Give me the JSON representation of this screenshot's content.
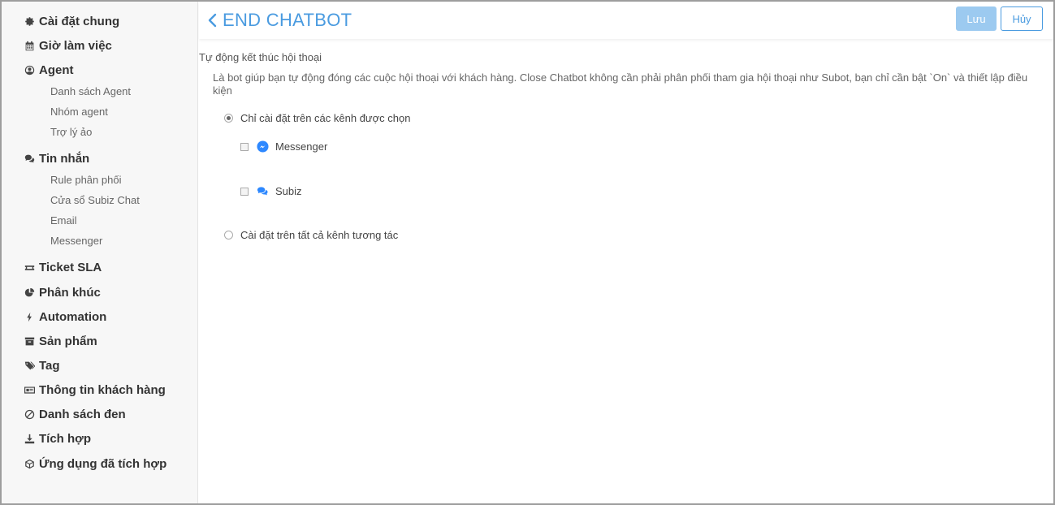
{
  "sidebar": {
    "items": [
      {
        "label": "Cài đặt chung",
        "icon": "gear-icon"
      },
      {
        "label": "Giờ làm việc",
        "icon": "calendar-icon"
      },
      {
        "label": "Agent",
        "icon": "user-circle-icon"
      },
      {
        "label": "Tin nhắn",
        "icon": "chat-bubbles-icon"
      },
      {
        "label": "Ticket SLA",
        "icon": "ticket-icon"
      },
      {
        "label": "Phân khúc",
        "icon": "pie-chart-icon"
      },
      {
        "label": "Automation",
        "icon": "bolt-icon"
      },
      {
        "label": "Sản phẩm",
        "icon": "archive-icon"
      },
      {
        "label": "Tag",
        "icon": "tags-icon"
      },
      {
        "label": "Thông tin khách hàng",
        "icon": "id-card-icon"
      },
      {
        "label": "Danh sách đen",
        "icon": "ban-icon"
      },
      {
        "label": "Tích hợp",
        "icon": "download-icon"
      },
      {
        "label": "Ứng dụng đã tích hợp",
        "icon": "cube-icon"
      }
    ],
    "agent_sub": [
      "Danh sách Agent",
      "Nhóm agent",
      "Trợ lý ảo"
    ],
    "message_sub": [
      "Rule phân phối",
      "Cửa sổ Subiz Chat",
      "Email",
      "Messenger"
    ]
  },
  "header": {
    "title": "END CHATBOT",
    "save_label": "Lưu",
    "cancel_label": "Hủy"
  },
  "main": {
    "section_title": "Tự động kết thúc hội thoại",
    "description": "Là bot giúp bạn tự động đóng các cuộc hội thoại với khách hàng. Close Chatbot không cần phải phân phối tham gia hội thoại như Subot, bạn chỉ cần bật `On` và thiết lập điều kiện",
    "option_selected": "Chỉ cài đặt trên các kênh được chọn",
    "channels": [
      {
        "label": "Messenger",
        "icon": "messenger-icon",
        "color": "#2d88ff"
      },
      {
        "label": "Subiz",
        "icon": "subiz-chat-icon",
        "color": "#2d88ff"
      }
    ],
    "option_all": "Cài đặt trên tất cả kênh tương tác"
  },
  "colors": {
    "accent": "#4a9be0",
    "save_button": "#9ccaf0",
    "sidebar_bg": "#f7f7f7"
  }
}
